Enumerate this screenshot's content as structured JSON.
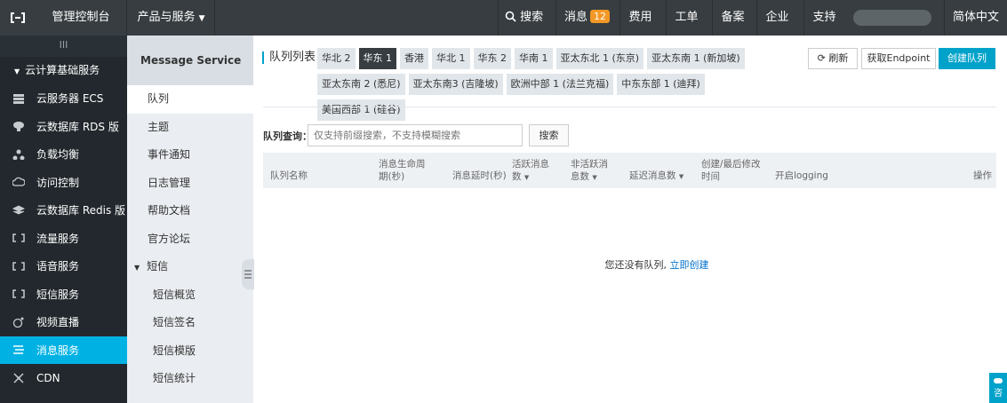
{
  "topbar": {
    "console_label": "管理控制台",
    "products_label": "产品与服务",
    "search_label": "搜索",
    "messages_label": "消息",
    "messages_count": "12",
    "nav": [
      "费用",
      "工单",
      "备案",
      "企业",
      "支持"
    ],
    "language": "简体中文"
  },
  "sidebar": {
    "toggle": "III",
    "group": "云计算基础服务",
    "items": [
      {
        "label": "云服务器 ECS",
        "icon": "server-icon"
      },
      {
        "label": "云数据库 RDS 版",
        "icon": "rds-icon"
      },
      {
        "label": "负载均衡",
        "icon": "load-balancer-icon"
      },
      {
        "label": "访问控制",
        "icon": "cloud-access-icon"
      },
      {
        "label": "云数据库 Redis 版",
        "icon": "redis-icon"
      },
      {
        "label": "流量服务",
        "icon": "bracket-icon"
      },
      {
        "label": "语音服务",
        "icon": "bracket-icon"
      },
      {
        "label": "短信服务",
        "icon": "bracket-icon"
      },
      {
        "label": "视频直播",
        "icon": "live-icon"
      },
      {
        "label": "消息服务",
        "icon": "message-icon"
      },
      {
        "label": "CDN",
        "icon": "cdn-icon"
      }
    ]
  },
  "subnav": {
    "title": "Message Service",
    "links": [
      "队列",
      "主题",
      "事件通知",
      "日志管理",
      "帮助文档",
      "官方论坛"
    ],
    "sms_group": "短信",
    "sms_items": [
      "短信概览",
      "短信签名",
      "短信模版",
      "短信统计"
    ]
  },
  "main": {
    "title": "队列列表",
    "regions": [
      "华北 2",
      "华东 1",
      "香港",
      "华北 1",
      "华东 2",
      "华南 1",
      "亚太东北 1 (东京)",
      "亚太东南 1 (新加坡)",
      "亚太东南 2 (悉尼)",
      "亚太东南3 (吉隆坡)",
      "欧洲中部 1 (法兰克福)",
      "中东东部 1 (迪拜)",
      "美国西部 1 (硅谷)"
    ],
    "active_region": "华东 1",
    "refresh_label": "刷新",
    "endpoint_label": "获取Endpoint",
    "create_label": "创建队列",
    "search_label": "队列查询：",
    "search_placeholder": "仅支持前缀搜索，不支持模糊搜索",
    "search_button": "搜索",
    "columns": {
      "name": "队列名称",
      "lifetime": "消息生命周期(秒)",
      "delay": "消息延时(秒)",
      "active": "活跃消息数",
      "inactive": "非活跃消息数",
      "delayed": "延迟消息数",
      "modified": "创建/最后修改时间",
      "logging": "开启logging",
      "ops": "操作"
    },
    "empty_text": "您还没有队列,",
    "empty_link": "立即创建"
  },
  "float_tab": "咨"
}
